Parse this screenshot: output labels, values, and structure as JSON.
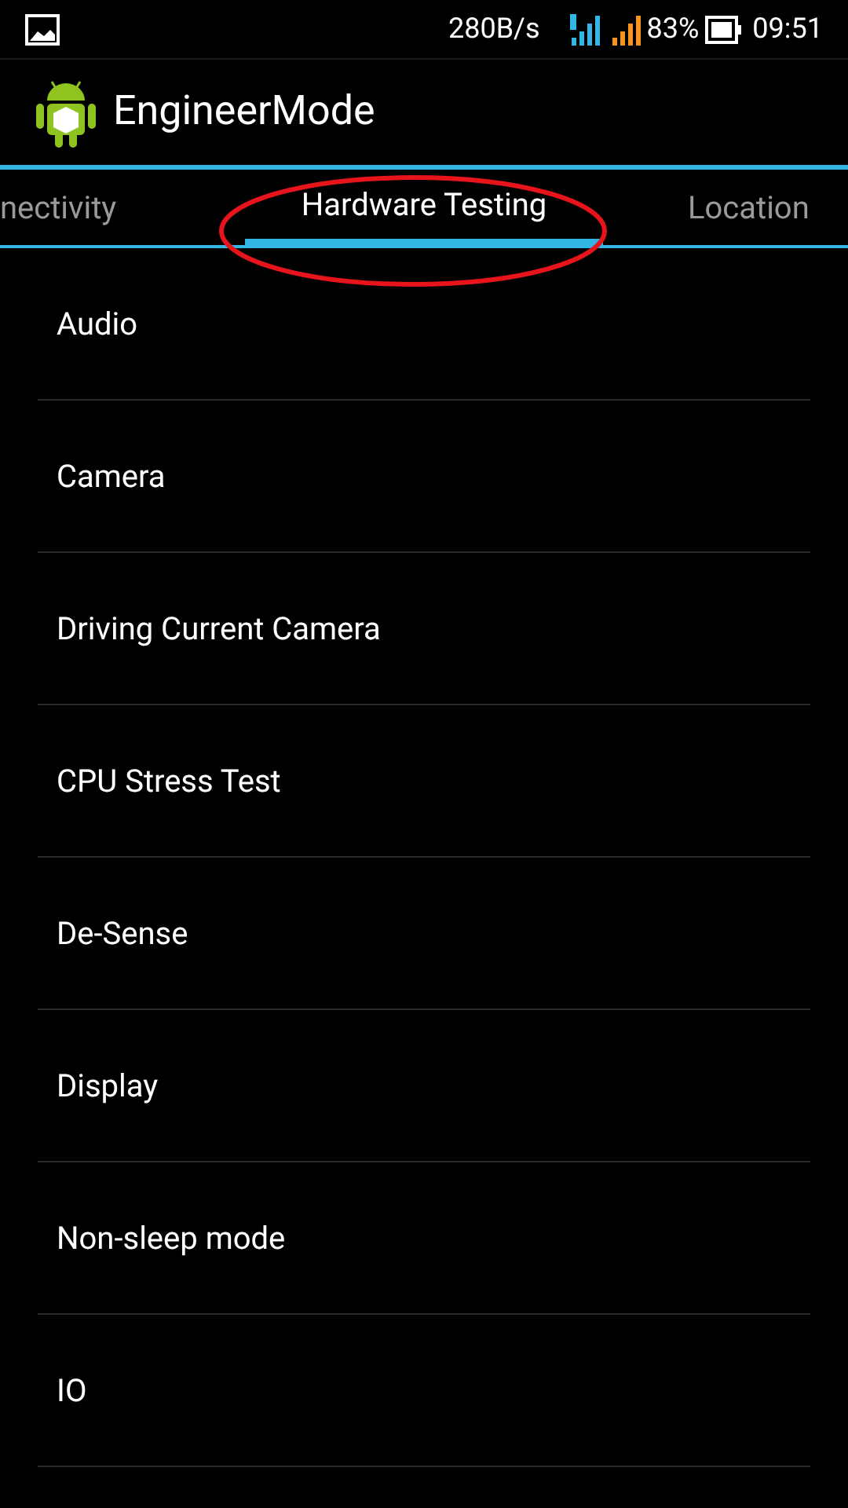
{
  "status_bar": {
    "speed": "280B/s",
    "battery": "83%",
    "time": "09:51"
  },
  "action_bar": {
    "title": "EngineerMode"
  },
  "tabs": [
    {
      "label": "nectivity",
      "selected": false
    },
    {
      "label": "Hardware Testing",
      "selected": true
    },
    {
      "label": "Location",
      "selected": false
    }
  ],
  "items": [
    "Audio",
    "Camera",
    "Driving Current Camera",
    "CPU Stress Test",
    "De-Sense",
    "Display",
    "Non-sleep mode",
    "IO"
  ]
}
